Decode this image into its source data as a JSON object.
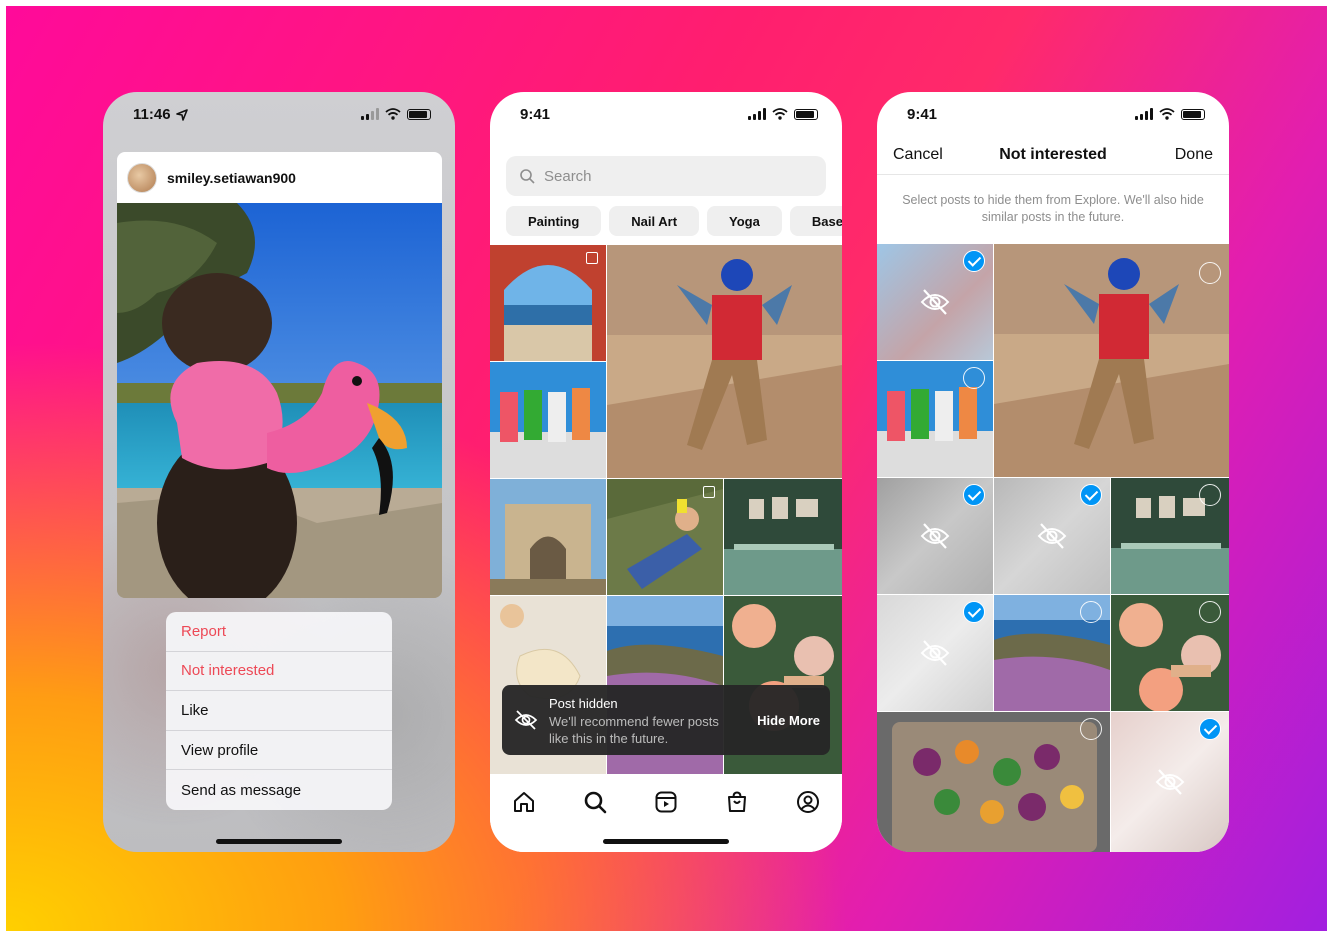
{
  "phone1": {
    "status_time": "11:46",
    "post": {
      "username": "smiley.setiawan900"
    },
    "menu": [
      {
        "label": "Report",
        "style": "danger"
      },
      {
        "label": "Not interested",
        "style": "danger"
      },
      {
        "label": "Like",
        "style": "normal"
      },
      {
        "label": "View profile",
        "style": "normal"
      },
      {
        "label": "Send as message",
        "style": "normal"
      }
    ]
  },
  "phone2": {
    "status_time": "9:41",
    "search": {
      "placeholder": "Search"
    },
    "chips": [
      "Painting",
      "Nail Art",
      "Yoga",
      "Base"
    ],
    "toast": {
      "title": "Post hidden",
      "body": "We'll recommend fewer posts like this in the future.",
      "action": "Hide More"
    },
    "tabs": [
      "home-icon",
      "search-icon",
      "reels-icon",
      "shop-icon",
      "profile-icon"
    ]
  },
  "phone3": {
    "status_time": "9:41",
    "nav": {
      "cancel": "Cancel",
      "title": "Not interested",
      "done": "Done"
    },
    "description": "Select posts to hide them from Explore. We'll also hide similar posts in the future."
  },
  "colors": {
    "danger": "#ed4956",
    "accent": "#0095f6",
    "bg_pink": "#ff0a9a",
    "bg_purple": "#a21fe0",
    "bg_yellow": "#ffd000"
  }
}
